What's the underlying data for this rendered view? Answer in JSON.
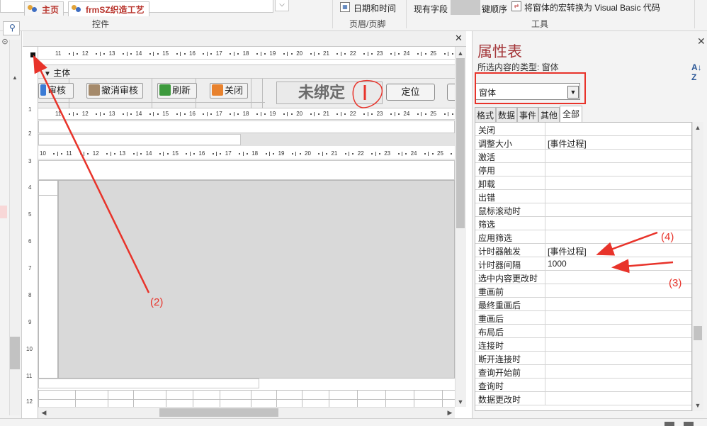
{
  "ribbon": {
    "faded_button": "",
    "controls_group_label": "控件",
    "date_time_label": "日期和时间",
    "header_footer_group_label": "页眉/页脚",
    "existing_fields_label": "现有字段",
    "tab_order_label": "键顺序",
    "convert_macros_label": "将窗体的宏转换为 Visual Basic 代码",
    "tools_group_label": "工具"
  },
  "tabs": [
    {
      "label": "主页"
    },
    {
      "label": "frmSZ织造工艺"
    }
  ],
  "designer": {
    "ruler_numbers": [
      "11",
      "12",
      "13",
      "14",
      "15",
      "16",
      "17",
      "18",
      "19",
      "20",
      "21",
      "22",
      "23",
      "24",
      "25"
    ],
    "ruler_numbers_offset": [
      "10",
      "11",
      "12",
      "13",
      "14",
      "15",
      "16",
      "17",
      "18",
      "19",
      "20",
      "21",
      "22",
      "23",
      "24",
      "25"
    ],
    "vertical_ruler_numbers": [
      "1",
      "2",
      "3",
      "4",
      "5",
      "6",
      "7",
      "8",
      "9",
      "10",
      "11",
      "12"
    ],
    "section_label": "主体",
    "buttons": {
      "review": "审核",
      "cancel_review": "撤消审核",
      "refresh": "刷新",
      "close": "关闭",
      "unbound": "未绑定",
      "locate": "定位"
    }
  },
  "property_sheet": {
    "title": "属性表",
    "selection_type_label": "所选内容的类型: 窗体",
    "selected_object": "窗体",
    "tabs": [
      "格式",
      "数据",
      "事件",
      "其他",
      "全部"
    ],
    "active_tab": "全部",
    "rows": [
      {
        "name": "关闭",
        "value": ""
      },
      {
        "name": "调整大小",
        "value": "[事件过程]"
      },
      {
        "name": "激活",
        "value": ""
      },
      {
        "name": "停用",
        "value": ""
      },
      {
        "name": "卸载",
        "value": ""
      },
      {
        "name": "出错",
        "value": ""
      },
      {
        "name": "鼠标滚动时",
        "value": ""
      },
      {
        "name": "筛选",
        "value": ""
      },
      {
        "name": "应用筛选",
        "value": ""
      },
      {
        "name": "计时器触发",
        "value": "[事件过程]"
      },
      {
        "name": "计时器间隔",
        "value": "1000"
      },
      {
        "name": "选中内容更改时",
        "value": ""
      },
      {
        "name": "重画前",
        "value": ""
      },
      {
        "name": "最终重画后",
        "value": ""
      },
      {
        "name": "重画后",
        "value": ""
      },
      {
        "name": "布局后",
        "value": ""
      },
      {
        "name": "连接时",
        "value": ""
      },
      {
        "name": "断开连接时",
        "value": ""
      },
      {
        "name": "查询开始前",
        "value": ""
      },
      {
        "name": "查询时",
        "value": ""
      },
      {
        "name": "数据更改时",
        "value": ""
      }
    ]
  },
  "annotations": {
    "label_2": "(2)",
    "label_3": "(3)",
    "label_4": "(4)",
    "color": "#e8332a"
  },
  "colors": {
    "property_title": "#a4373a",
    "tab_label": "#b8332b",
    "annotation": "#e8332a"
  }
}
